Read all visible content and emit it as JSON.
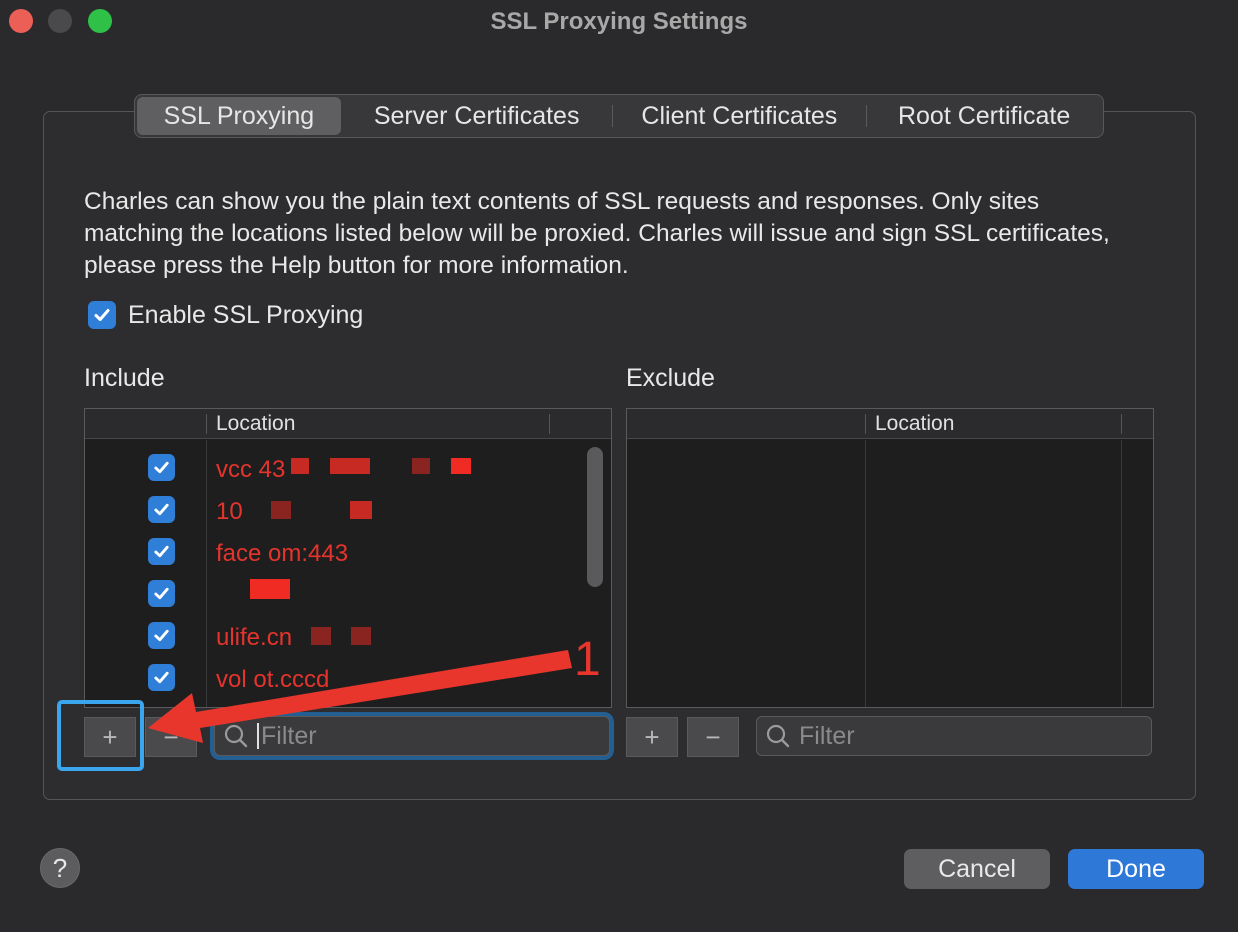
{
  "window": {
    "title": "SSL Proxying Settings"
  },
  "tabs": [
    {
      "label": "SSL Proxying",
      "active": true
    },
    {
      "label": "Server Certificates",
      "active": false
    },
    {
      "label": "Client Certificates",
      "active": false
    },
    {
      "label": "Root Certificate",
      "active": false
    }
  ],
  "description": "Charles can show you the plain text contents of SSL requests and responses. Only sites matching the locations listed below will be proxied. Charles will issue and sign SSL certificates, please press the Help button for more information.",
  "enable": {
    "label": "Enable SSL Proxying",
    "checked": true
  },
  "include": {
    "label": "Include",
    "column": "Location",
    "rows": [
      {
        "location": "vcc                         43",
        "checked": true
      },
      {
        "location": "10",
        "checked": true
      },
      {
        "location": "face                      om:443",
        "checked": true
      },
      {
        "location": "",
        "checked": true
      },
      {
        "location": "                          ulife.cn",
        "checked": true
      },
      {
        "location": "vol       ot.cccd",
        "checked": true
      }
    ],
    "add_symbol": "+",
    "remove_symbol": "−",
    "filter_placeholder": "Filter"
  },
  "exclude": {
    "label": "Exclude",
    "column": "Location",
    "add_symbol": "+",
    "remove_symbol": "−",
    "filter_placeholder": "Filter"
  },
  "footer": {
    "help": "?",
    "cancel": "Cancel",
    "done": "Done"
  },
  "annotation": {
    "number": "1",
    "color": "#e8362d",
    "highlight_color": "#3ba5ee"
  },
  "colors": {
    "accent": "#2e78d8",
    "location_text": "#e5342c"
  }
}
